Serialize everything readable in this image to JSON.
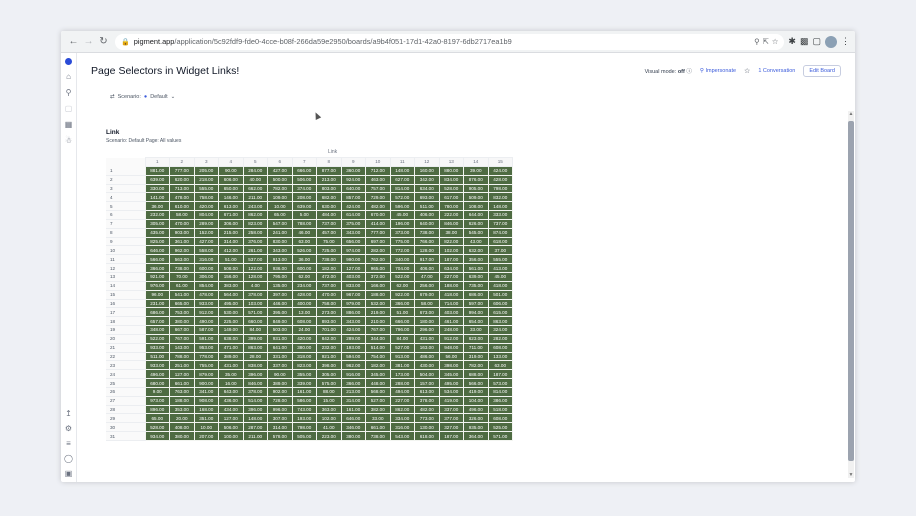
{
  "browser": {
    "url": "pigment.app/application/5c92fdf9-fde0-4cce-b08f-266da59e2950/boards/a9b4f051-17d1-42a0-8197-6db2717ea1b9",
    "url_host": "pigment.app",
    "url_path": "/application/5c92fdf9-fde0-4cce-b08f-266da59e2950/boards/a9b4f051-17d1-42a0-8197-6db2717ea1b9"
  },
  "page": {
    "title": "Page Selectors in Widget Links!",
    "visual_mode_label": "Visual mode:",
    "visual_mode_value": "off",
    "impersonate": "Impersonate",
    "conversation": "1 Conversation",
    "edit_board": "Edit Board"
  },
  "filters": {
    "scenario_label": "Scenario:",
    "scenario_value": "Default"
  },
  "widget": {
    "title": "Link",
    "subtitle": "Scenario: Default  Page: All values",
    "column_group": "Link",
    "columns": [
      "1",
      "2",
      "3",
      "4",
      "5",
      "6",
      "7",
      "8",
      "9",
      "10",
      "11",
      "12",
      "13",
      "14",
      "15"
    ],
    "rows": [
      {
        "label": "1",
        "cells": [
          "881.00",
          "777.00",
          "205.00",
          "90.00",
          "284.00",
          "427.00",
          "666.00",
          "877.00",
          "360.00",
          "712.00",
          "148.00",
          "160.00",
          "880.00",
          "39.00",
          "424.00"
        ]
      },
      {
        "label": "2",
        "cells": [
          "639.00",
          "620.00",
          "218.00",
          "606.00",
          "40.00",
          "500.00",
          "506.00",
          "213.00",
          "924.00",
          "463.00",
          "627.00",
          "342.00",
          "834.00",
          "876.00",
          "428.00"
        ]
      },
      {
        "label": "3",
        "cells": [
          "330.00",
          "713.00",
          "555.00",
          "650.00",
          "662.00",
          "782.00",
          "374.00",
          "803.00",
          "640.00",
          "757.00",
          "814.00",
          "634.00",
          "528.00",
          "905.00",
          "798.00"
        ]
      },
      {
        "label": "4",
        "cells": [
          "141.00",
          "478.00",
          "758.00",
          "146.00",
          "211.00",
          "109.00",
          "208.00",
          "682.00",
          "857.00",
          "729.00",
          "572.00",
          "693.00",
          "617.00",
          "509.00",
          "832.00"
        ]
      },
      {
        "label": "5",
        "cells": [
          "36.00",
          "610.00",
          "420.00",
          "613.00",
          "243.00",
          "10.00",
          "639.00",
          "630.00",
          "424.00",
          "482.00",
          "596.00",
          "511.00",
          "780.00",
          "108.00",
          "148.00"
        ]
      },
      {
        "label": "6",
        "cells": [
          "232.00",
          "58.00",
          "804.00",
          "671.00",
          "862.00",
          "65.00",
          "5.00",
          "484.00",
          "614.00",
          "670.00",
          "45.00",
          "406.00",
          "222.00",
          "644.00",
          "333.00"
        ]
      },
      {
        "label": "7",
        "cells": [
          "305.00",
          "470.00",
          "289.00",
          "306.00",
          "823.00",
          "547.00",
          "788.00",
          "737.00",
          "375.00",
          "414.00",
          "196.00",
          "640.00",
          "846.00",
          "626.00",
          "737.00"
        ]
      },
      {
        "label": "8",
        "cells": [
          "435.00",
          "903.00",
          "152.00",
          "215.00",
          "258.00",
          "241.00",
          "46.00",
          "457.00",
          "343.00",
          "777.00",
          "373.00",
          "738.00",
          "38.00",
          "545.00",
          "874.00"
        ]
      },
      {
        "label": "9",
        "cells": [
          "825.00",
          "361.00",
          "427.00",
          "314.00",
          "376.00",
          "830.00",
          "63.00",
          "75.00",
          "656.00",
          "697.00",
          "775.00",
          "766.00",
          "822.00",
          "43.00",
          "618.00"
        ]
      },
      {
        "label": "10",
        "cells": [
          "646.00",
          "962.00",
          "558.00",
          "412.00",
          "261.00",
          "343.00",
          "526.00",
          "725.00",
          "974.00",
          "282.00",
          "772.00",
          "128.00",
          "102.00",
          "632.00",
          "37.00"
        ]
      },
      {
        "label": "11",
        "cells": [
          "566.00",
          "563.00",
          "316.00",
          "51.00",
          "537.00",
          "913.00",
          "36.00",
          "738.00",
          "990.00",
          "762.00",
          "340.00",
          "917.00",
          "187.00",
          "356.00",
          "555.00"
        ]
      },
      {
        "label": "12",
        "cells": [
          "366.00",
          "738.00",
          "600.00",
          "508.00",
          "122.00",
          "936.00",
          "600.00",
          "182.00",
          "127.00",
          "965.00",
          "704.00",
          "406.00",
          "634.00",
          "561.00",
          "413.00"
        ]
      },
      {
        "label": "13",
        "cells": [
          "921.00",
          "70.00",
          "306.00",
          "156.00",
          "128.00",
          "795.00",
          "62.00",
          "472.00",
          "403.00",
          "372.00",
          "522.00",
          "47.00",
          "227.00",
          "639.00",
          "45.00"
        ]
      },
      {
        "label": "14",
        "cells": [
          "976.00",
          "61.00",
          "854.00",
          "383.00",
          "4.00",
          "135.00",
          "234.00",
          "737.00",
          "833.00",
          "166.00",
          "62.00",
          "256.00",
          "188.00",
          "735.00",
          "418.00"
        ]
      },
      {
        "label": "15",
        "cells": [
          "96.00",
          "541.00",
          "478.00",
          "564.00",
          "378.00",
          "397.00",
          "428.00",
          "470.00",
          "967.00",
          "188.00",
          "922.00",
          "679.00",
          "418.00",
          "686.00",
          "501.00"
        ]
      },
      {
        "label": "16",
        "cells": [
          "231.00",
          "665.00",
          "933.00",
          "495.00",
          "103.00",
          "446.00",
          "400.00",
          "758.00",
          "979.00",
          "532.00",
          "366.00",
          "58.00",
          "714.00",
          "597.00",
          "606.00"
        ]
      },
      {
        "label": "17",
        "cells": [
          "686.00",
          "753.00",
          "912.00",
          "530.00",
          "571.00",
          "395.00",
          "13.00",
          "273.00",
          "886.00",
          "219.00",
          "51.00",
          "673.00",
          "403.00",
          "994.00",
          "615.00"
        ]
      },
      {
        "label": "18",
        "cells": [
          "657.00",
          "380.00",
          "490.00",
          "225.00",
          "660.00",
          "849.00",
          "608.00",
          "893.00",
          "343.00",
          "210.00",
          "666.00",
          "180.00",
          "461.00",
          "654.00",
          "863.00"
        ]
      },
      {
        "label": "19",
        "cells": [
          "348.00",
          "667.00",
          "587.00",
          "149.00",
          "84.00",
          "503.00",
          "24.00",
          "701.00",
          "424.00",
          "767.00",
          "796.00",
          "296.00",
          "248.00",
          "33.00",
          "324.00"
        ]
      },
      {
        "label": "20",
        "cells": [
          "522.00",
          "767.00",
          "591.00",
          "638.00",
          "399.00",
          "931.00",
          "420.00",
          "842.00",
          "289.00",
          "344.00",
          "84.00",
          "431.00",
          "912.00",
          "623.00",
          "282.00"
        ]
      },
      {
        "label": "21",
        "cells": [
          "933.00",
          "143.00",
          "953.00",
          "471.00",
          "863.00",
          "641.00",
          "380.00",
          "232.00",
          "193.00",
          "514.00",
          "527.00",
          "163.00",
          "948.00",
          "711.00",
          "608.00"
        ]
      },
      {
        "label": "22",
        "cells": [
          "511.00",
          "788.00",
          "778.00",
          "389.00",
          "28.00",
          "331.00",
          "318.00",
          "921.00",
          "594.00",
          "754.00",
          "913.00",
          "486.00",
          "56.00",
          "319.00",
          "133.00"
        ]
      },
      {
        "label": "23",
        "cells": [
          "933.00",
          "251.00",
          "755.00",
          "431.00",
          "838.00",
          "337.00",
          "823.00",
          "398.00",
          "962.00",
          "182.00",
          "381.00",
          "430.00",
          "398.00",
          "782.00",
          "63.00"
        ]
      },
      {
        "label": "24",
        "cells": [
          "496.00",
          "127.00",
          "879.00",
          "35.00",
          "396.00",
          "90.00",
          "355.00",
          "305.00",
          "916.00",
          "345.00",
          "173.00",
          "504.00",
          "345.00",
          "688.00",
          "187.00"
        ]
      },
      {
        "label": "25",
        "cells": [
          "680.00",
          "661.00",
          "900.00",
          "16.00",
          "846.00",
          "389.00",
          "339.00",
          "575.00",
          "366.00",
          "448.00",
          "288.00",
          "157.00",
          "495.00",
          "566.00",
          "573.00"
        ]
      },
      {
        "label": "26",
        "cells": [
          "9.00",
          "763.00",
          "341.00",
          "643.00",
          "378.00",
          "902.00",
          "161.00",
          "88.00",
          "213.00",
          "568.00",
          "494.00",
          "613.00",
          "534.00",
          "419.00",
          "814.00"
        ]
      },
      {
        "label": "27",
        "cells": [
          "973.00",
          "188.00",
          "908.00",
          "436.00",
          "514.00",
          "728.00",
          "586.00",
          "15.00",
          "314.00",
          "527.00",
          "227.00",
          "378.00",
          "419.00",
          "104.00",
          "386.00"
        ]
      },
      {
        "label": "28",
        "cells": [
          "896.00",
          "353.00",
          "168.00",
          "434.00",
          "396.00",
          "996.00",
          "743.00",
          "363.00",
          "161.00",
          "382.00",
          "862.00",
          "482.00",
          "337.00",
          "496.00",
          "518.00"
        ]
      },
      {
        "label": "29",
        "cells": [
          "65.00",
          "20.00",
          "351.00",
          "127.00",
          "148.00",
          "307.00",
          "193.00",
          "102.00",
          "646.00",
          "33.00",
          "334.00",
          "773.00",
          "377.00",
          "326.00",
          "608.00"
        ]
      },
      {
        "label": "30",
        "cells": [
          "528.00",
          "408.00",
          "10.00",
          "506.00",
          "287.00",
          "314.00",
          "798.00",
          "41.00",
          "346.00",
          "661.00",
          "316.00",
          "130.00",
          "327.00",
          "935.00",
          "525.00"
        ]
      },
      {
        "label": "31",
        "cells": [
          "934.00",
          "380.00",
          "207.00",
          "100.00",
          "211.00",
          "578.00",
          "505.00",
          "223.00",
          "380.00",
          "738.00",
          "543.00",
          "618.00",
          "187.00",
          "364.00",
          "571.00"
        ]
      }
    ]
  },
  "colors": {
    "cell_bg": "#4e6b42",
    "accent": "#3b5bdb"
  }
}
